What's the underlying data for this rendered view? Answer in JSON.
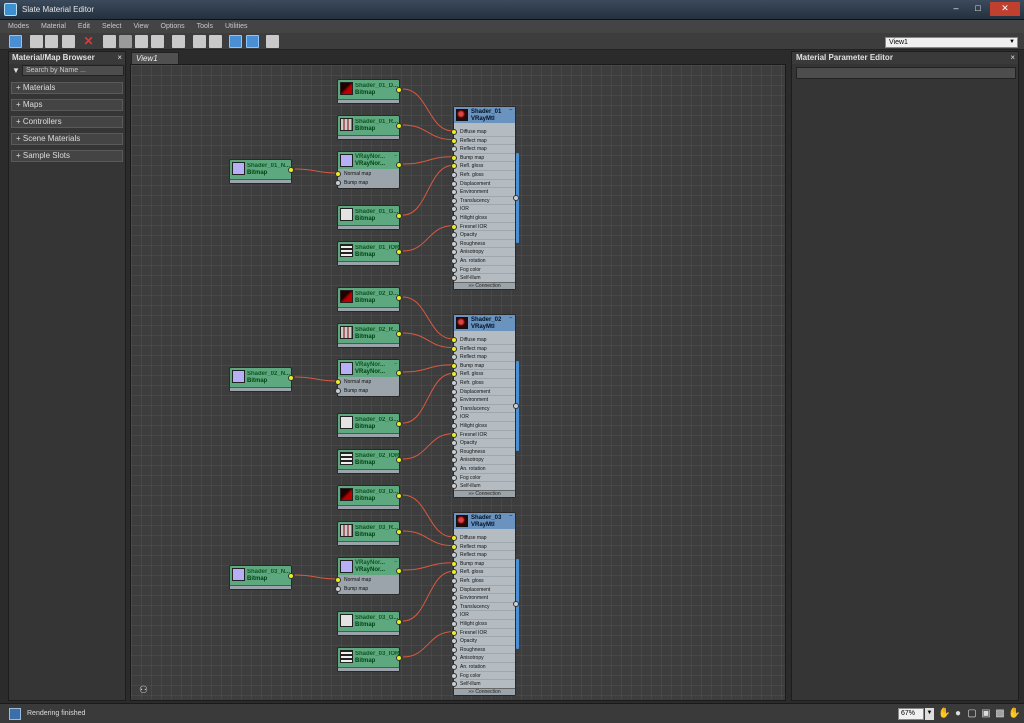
{
  "window": {
    "title": "Slate Material Editor"
  },
  "menu": [
    "Modes",
    "Material",
    "Edit",
    "Select",
    "View",
    "Options",
    "Tools",
    "Utilities"
  ],
  "toolbar": {
    "view_select": "View1"
  },
  "browser": {
    "title": "Material/Map Browser",
    "close": "×",
    "search_placeholder": "Search by Name ...",
    "groups": [
      "+ Materials",
      "+ Maps",
      "+ Controllers",
      "+ Scene Materials",
      "+ Sample Slots"
    ]
  },
  "view": {
    "tab": "View1"
  },
  "shaders": [
    {
      "diffuse": "Shader_01_D...",
      "reflect": "Shader_01_R...",
      "normal": "Shader_01_N...",
      "gloss": "Shader_01_G...",
      "ior": "Shader_01_IOR",
      "material": "Shader_01"
    },
    {
      "diffuse": "Shader_02_D...",
      "reflect": "Shader_02_R...",
      "normal": "Shader_02_N...",
      "gloss": "Shader_02_G...",
      "ior": "Shader_02_IOR",
      "material": "Shader_02"
    },
    {
      "diffuse": "Shader_03_D...",
      "reflect": "Shader_03_R...",
      "normal": "Shader_03_N...",
      "gloss": "Shader_03_G...",
      "ior": "Shader_03_IOR",
      "material": "Shader_03"
    }
  ],
  "node_labels": {
    "bitmap": "Bitmap",
    "vraynormal_name": "VRayNor...",
    "vraynormal_type": "VRayNor...",
    "normal_slot": "Normal map",
    "bump_slot": "Bump map",
    "vraymtl_type": "VRayMtl",
    "connection": "»» Connection"
  },
  "vraymtl_slots": [
    "Diffuse map",
    "Reflect map",
    "Reflect map",
    "Bump map",
    "Refl. gloss",
    "Refr. gloss",
    "Displacement",
    "Environment",
    "Translucency",
    "IOR",
    "Hilight gloss",
    "Fresnel IOR",
    "Opacity",
    "Roughness",
    "Anisotropy",
    "An. rotation",
    "Fog color",
    "Self-illum"
  ],
  "params": {
    "title": "Material Parameter Editor",
    "close": "×"
  },
  "status": {
    "text": "Rendering finished",
    "zoom": "67%"
  }
}
